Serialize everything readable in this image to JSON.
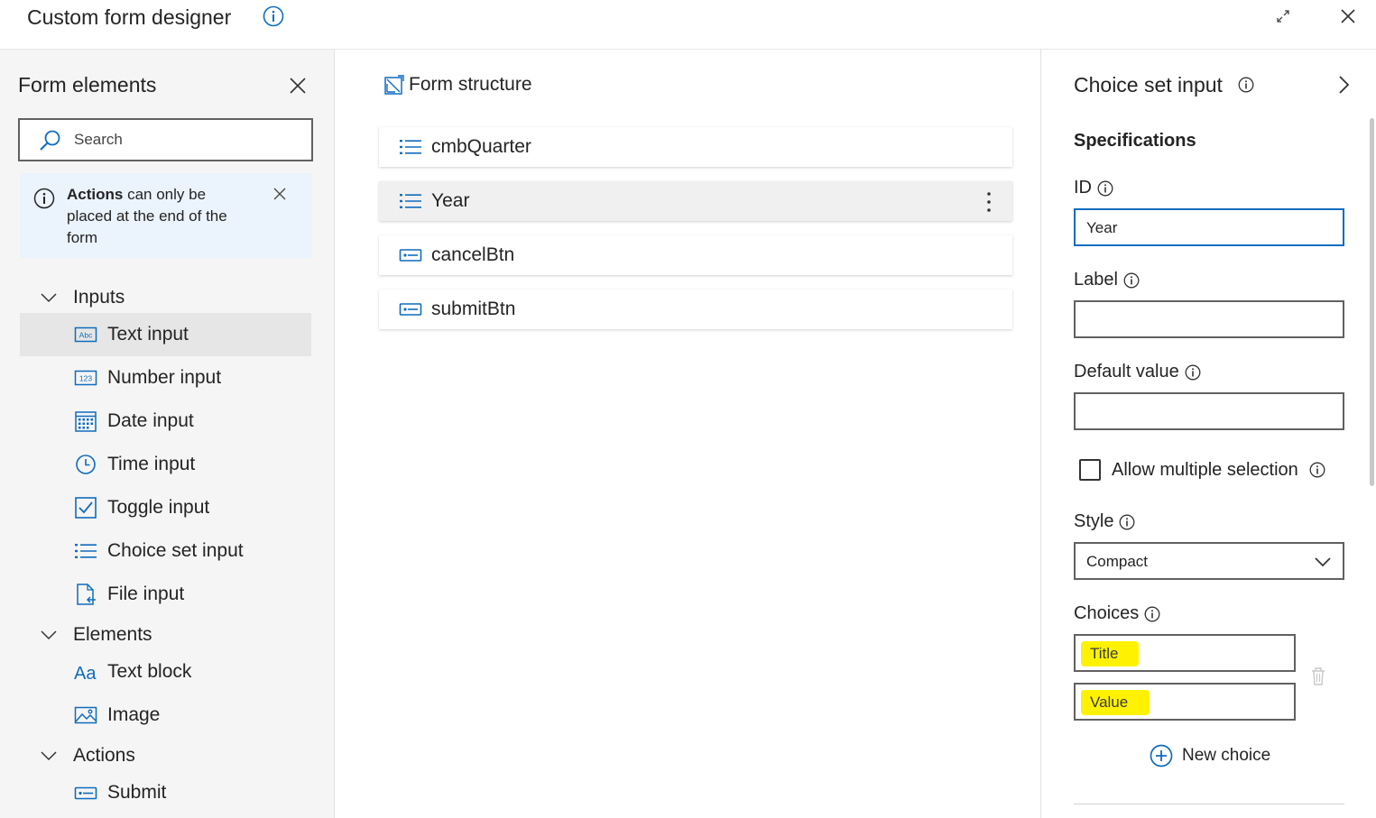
{
  "window": {
    "title": "Custom form designer"
  },
  "left_panel": {
    "title": "Form elements",
    "search_placeholder": "Search",
    "notice": {
      "bold": "Actions",
      "text": " can only be placed at the end of the form"
    },
    "groups": {
      "inputs": {
        "label": "Inputs",
        "items": [
          {
            "label": "Text input",
            "icon": "text-input-icon"
          },
          {
            "label": "Number input",
            "icon": "number-input-icon"
          },
          {
            "label": "Date input",
            "icon": "calendar-icon"
          },
          {
            "label": "Time input",
            "icon": "clock-icon"
          },
          {
            "label": "Toggle input",
            "icon": "checkbox-icon"
          },
          {
            "label": "Choice set input",
            "icon": "list-icon"
          },
          {
            "label": "File input",
            "icon": "file-icon"
          }
        ]
      },
      "elements": {
        "label": "Elements",
        "items": [
          {
            "label": "Text block",
            "icon": "text-block-icon",
            "glyph": "Aa"
          },
          {
            "label": "Image",
            "icon": "image-icon"
          }
        ]
      },
      "actions": {
        "label": "Actions",
        "items": [
          {
            "label": "Submit",
            "icon": "button-icon"
          }
        ]
      }
    }
  },
  "center_panel": {
    "title": "Form structure",
    "rows": [
      {
        "label": "cmbQuarter",
        "icon": "list-icon"
      },
      {
        "label": "Year",
        "icon": "list-icon",
        "selected": true
      },
      {
        "label": "cancelBtn",
        "icon": "button-icon"
      },
      {
        "label": "submitBtn",
        "icon": "button-icon"
      }
    ]
  },
  "right_panel": {
    "title": "Choice set input",
    "section": "Specifications",
    "id_label": "ID",
    "id_value": "Year",
    "label_label": "Label",
    "label_value": "",
    "default_label": "Default value",
    "default_value": "",
    "allow_multiple_label": "Allow multiple selection",
    "allow_multiple_checked": false,
    "style_label": "Style",
    "style_value": "Compact",
    "choices_label": "Choices",
    "choice_title_placeholder": "Title",
    "choice_value_placeholder": "Value",
    "new_choice_label": "New choice"
  },
  "colors": {
    "accent": "#0f6cbd",
    "highlight": "#fff200",
    "panel_bg": "#f5f5f5"
  }
}
